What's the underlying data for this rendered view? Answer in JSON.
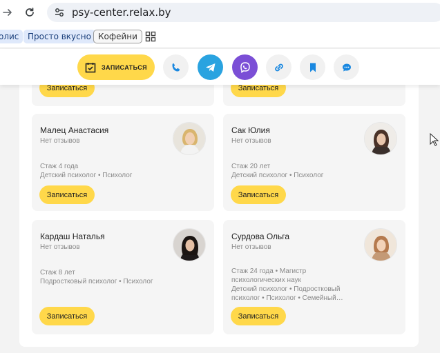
{
  "browser": {
    "url": "psy-center.relax.by",
    "back_icon": "arrow-right-icon",
    "reload_icon": "reload-icon",
    "site_info_icon": "tune-icon"
  },
  "bookmarks": {
    "items": [
      {
        "label": "олис",
        "style": "blue"
      },
      {
        "label": "Просто вкусно",
        "style": "blue"
      },
      {
        "label": "Кофейни",
        "style": "outline"
      }
    ],
    "apps_icon": "grid-icon"
  },
  "actionbar": {
    "book_label": "ЗАПИСАТЬСЯ",
    "buttons": [
      "phone-icon",
      "telegram-icon",
      "viber-icon",
      "link-icon",
      "bookmark-icon",
      "chat-icon"
    ],
    "colors": {
      "yellow": "#ffd84a",
      "telegram": "#2aa3e0",
      "viber": "#7b4fd6",
      "accent_blue": "#1a88e0"
    }
  },
  "cards": {
    "book_label": "Записаться",
    "top_left_button": "Записаться",
    "top_right_button": "Записаться",
    "items": [
      {
        "name": "Малец Анастасия",
        "reviews": "Нет отзывов",
        "line1": "Стаж 4 года",
        "line2": "Детский психолог • Психолог",
        "line3": "",
        "line4": "",
        "button": "Записаться"
      },
      {
        "name": "Сак Юлия",
        "reviews": "Нет отзывов",
        "line1": "Стаж 20 лет",
        "line2": "Детский психолог • Психолог",
        "line3": "",
        "line4": "",
        "button": "Записаться"
      },
      {
        "name": "Кардаш Наталья",
        "reviews": "Нет отзывов",
        "line1": "Стаж 8 лет",
        "line2": "Подростковый психолог • Психолог",
        "line3": "",
        "line4": "",
        "button": "Записаться"
      },
      {
        "name": "Сурдова Ольга",
        "reviews": "Нет отзывов",
        "line1": "Стаж 24 года • Магистр",
        "line2": "психологических наук",
        "line3": "Детский психолог • Подростковый",
        "line4": "психолог • Психолог • Семейный…",
        "button": "Записаться"
      }
    ]
  }
}
